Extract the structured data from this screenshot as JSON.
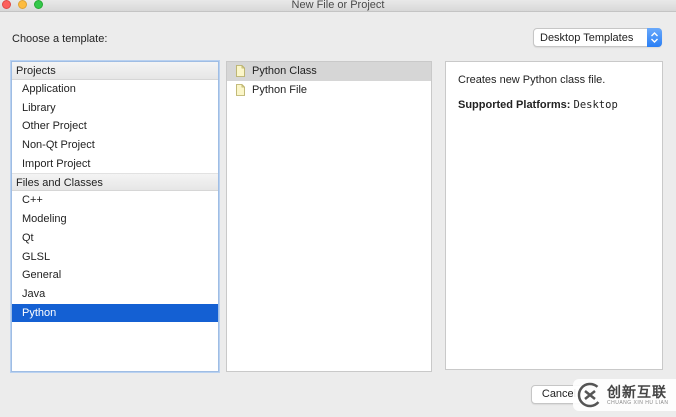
{
  "window": {
    "title": "New File or Project"
  },
  "header": {
    "choose_label": "Choose a template:"
  },
  "platform_select": {
    "value": "Desktop Templates"
  },
  "categories": {
    "groups": [
      {
        "label": "Projects",
        "items": [
          "Application",
          "Library",
          "Other Project",
          "Non-Qt Project",
          "Import Project"
        ]
      },
      {
        "label": "Files and Classes",
        "items": [
          "C++",
          "Modeling",
          "Qt",
          "GLSL",
          "General",
          "Java",
          "Python"
        ]
      }
    ],
    "selected": "Python"
  },
  "templates": {
    "items": [
      "Python Class",
      "Python File"
    ],
    "selected": "Python Class"
  },
  "details": {
    "description": "Creates new Python class file.",
    "platforms_label": "Supported Platforms:",
    "platforms_value": "Desktop"
  },
  "buttons": {
    "cancel": "Cancel"
  },
  "watermark": {
    "text": "创新互联",
    "subtext": "CHUANG XIN HU LIAN"
  },
  "colors": {
    "selection": "#1460d3",
    "accent": "#2a7ff5"
  }
}
